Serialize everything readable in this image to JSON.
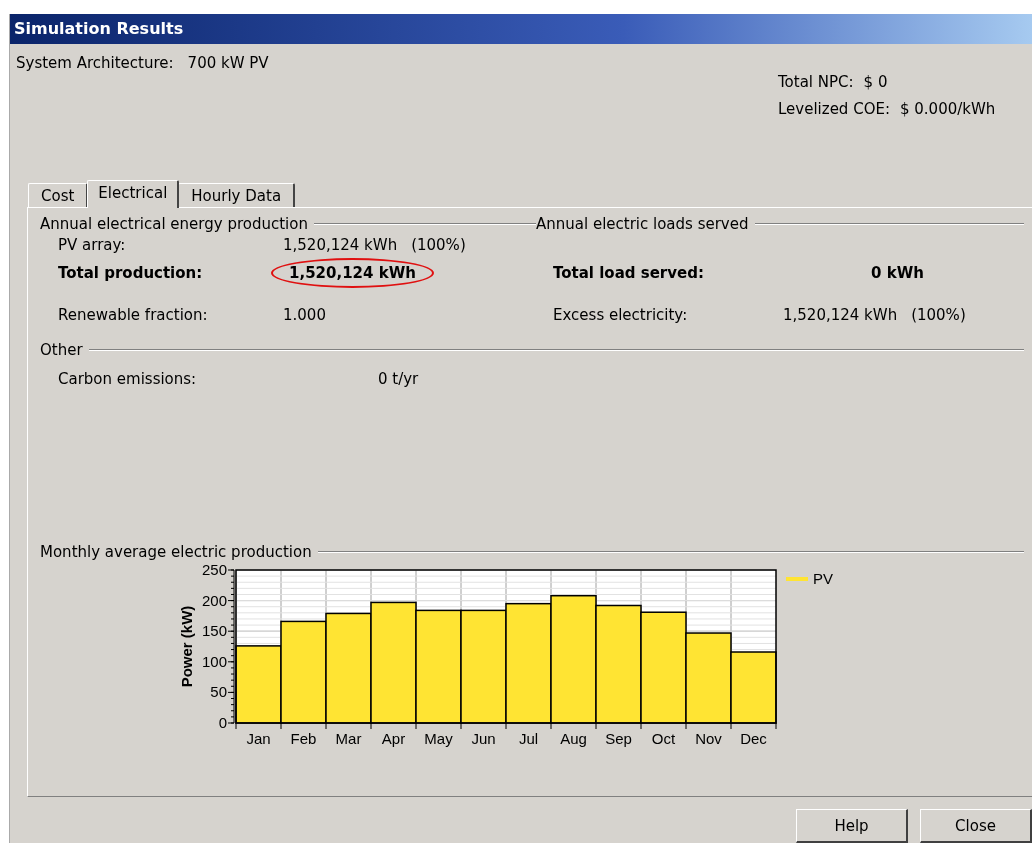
{
  "window": {
    "title": "Simulation Results"
  },
  "architecture": {
    "label": "System Architecture:",
    "value": "700 kW PV"
  },
  "summary": [
    {
      "label": "Total NPC:",
      "value": "$ 0"
    },
    {
      "label": "Levelized COE:",
      "value": "$ 0.000/kWh"
    }
  ],
  "tabs": [
    {
      "label": "Cost",
      "selected": false
    },
    {
      "label": "Electrical",
      "selected": true
    },
    {
      "label": "Hourly Data",
      "selected": false
    }
  ],
  "production": {
    "title": "Annual electrical energy production",
    "rows": [
      {
        "label": "PV array:",
        "value": "1,520,124 kWh",
        "share": "(100%)",
        "bold": false,
        "highlighted": false
      },
      {
        "label": "Total production:",
        "value": "1,520,124 kWh",
        "bold": true,
        "highlighted": true
      },
      {
        "label": "Renewable fraction:",
        "value": "1.000",
        "bold": false,
        "highlighted": false
      }
    ]
  },
  "loads": {
    "title": "Annual electric loads served",
    "rows": [
      {
        "label": "Total load served:",
        "value": "0 kWh",
        "bold": true
      },
      {
        "label": "Excess electricity:",
        "value": "1,520,124 kWh",
        "share": "(100%)",
        "bold": false
      }
    ]
  },
  "other": {
    "title": "Other",
    "rows": [
      {
        "label": "Carbon emissions:",
        "value": "0 t/yr"
      }
    ]
  },
  "monthly": {
    "title": "Monthly average electric production",
    "chart_data": {
      "type": "bar",
      "ylabel": "Power (kW)",
      "categories": [
        "Jan",
        "Feb",
        "Mar",
        "Apr",
        "May",
        "Jun",
        "Jul",
        "Aug",
        "Sep",
        "Oct",
        "Nov",
        "Dec"
      ],
      "series": [
        {
          "name": "PV",
          "color": "#ffe433",
          "values": [
            126,
            166,
            179,
            197,
            184,
            184,
            195,
            208,
            192,
            181,
            147,
            116
          ]
        }
      ],
      "ylim": [
        0,
        250
      ],
      "grid": true,
      "yticks": [
        0,
        50,
        100,
        150,
        200,
        250
      ]
    }
  },
  "buttons": [
    {
      "label": "Help"
    },
    {
      "label": "Close"
    }
  ]
}
